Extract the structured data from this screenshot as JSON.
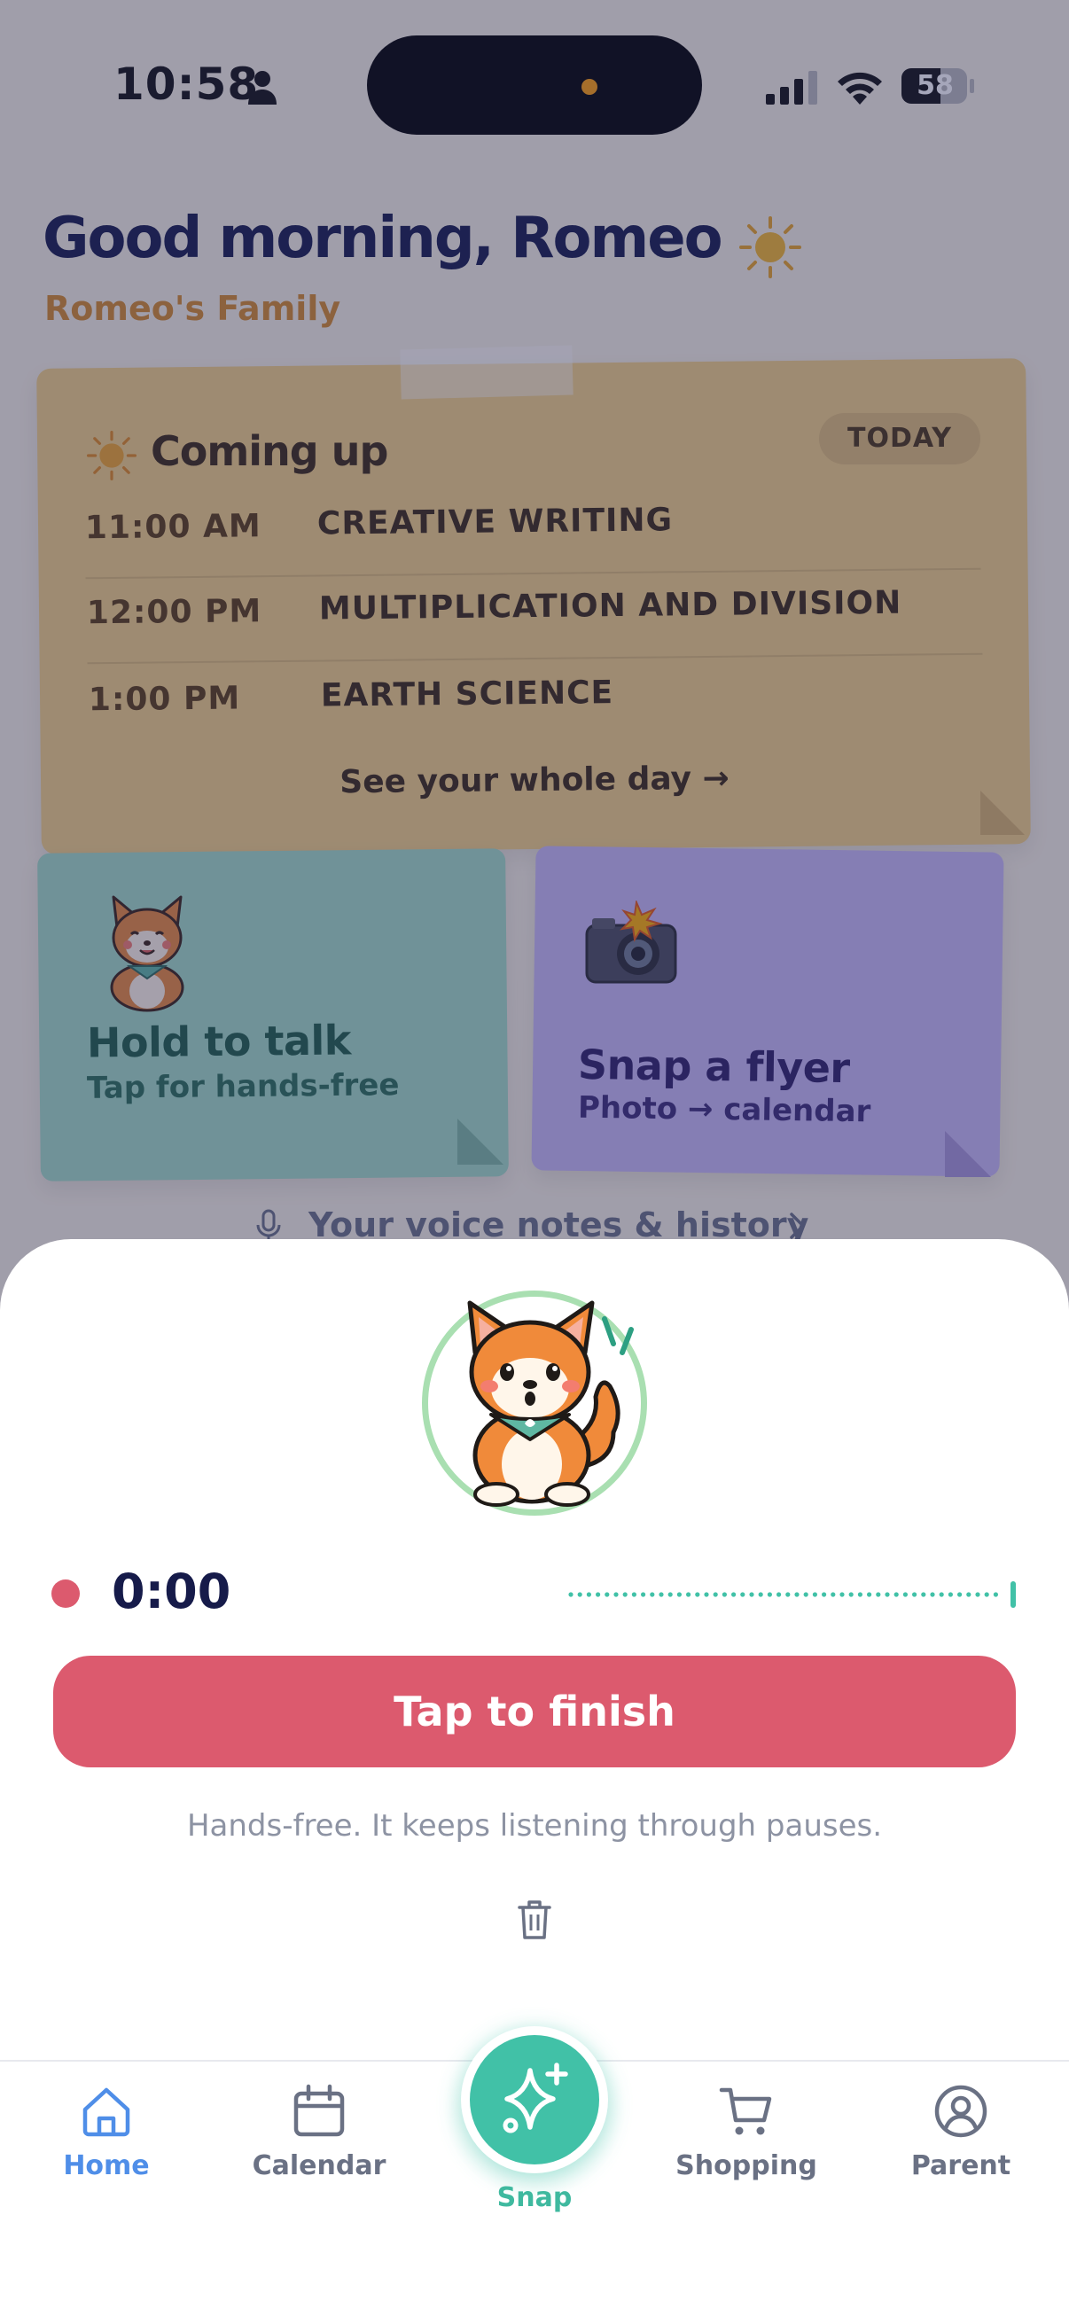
{
  "status_bar": {
    "time": "10:58",
    "battery": "58"
  },
  "greeting": {
    "title": "Good morning, Romeo",
    "family": "Romeo's Family"
  },
  "coming_up": {
    "title": "Coming up",
    "badge": "TODAY",
    "events": [
      {
        "time": "11:00 AM",
        "name": "CREATIVE WRITING"
      },
      {
        "time": "12:00 PM",
        "name": "MULTIPLICATION AND DIVISION"
      },
      {
        "time": "1:00 PM",
        "name": "EARTH SCIENCE"
      }
    ],
    "see_day": "See your whole day →"
  },
  "hold_card": {
    "title": "Hold to talk",
    "subtitle": "Tap for hands-free"
  },
  "snap_card": {
    "title": "Snap a flyer",
    "subtitle": "Photo → calendar"
  },
  "voice_notes_link": "Your voice notes & history",
  "recorder": {
    "timer": "0:00",
    "finish_label": "Tap to finish",
    "hint": "Hands-free. It keeps listening through pauses."
  },
  "tabbar": {
    "home": "Home",
    "calendar": "Calendar",
    "snap": "Snap",
    "shopping": "Shopping",
    "parent": "Parent"
  },
  "colors": {
    "navy": "#161b4a",
    "record_red": "#dc5a6e",
    "teal": "#41c1a7",
    "active_tab": "#4f8ee8",
    "card_yellow": "#f3d184",
    "card_green": "#a4dcc4",
    "card_purple": "#c9baf5"
  }
}
